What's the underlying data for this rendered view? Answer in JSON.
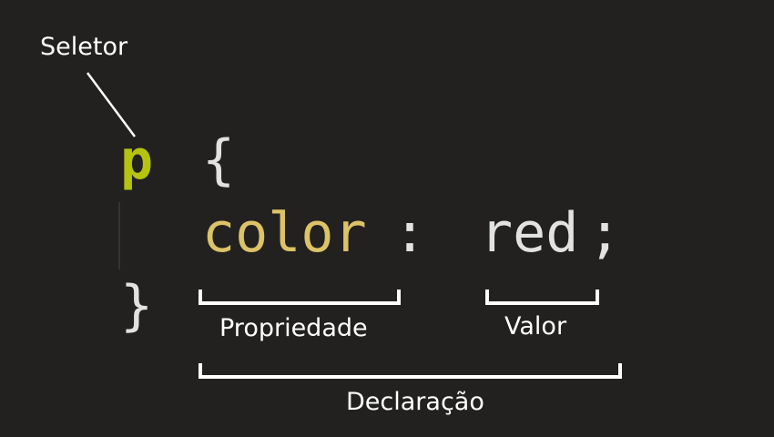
{
  "code": {
    "selector": "p",
    "open_brace": "{",
    "property": "color",
    "colon": ":",
    "value": "red",
    "semicolon": ";",
    "close_brace": "}"
  },
  "labels": {
    "selector": "Seletor",
    "property": "Propriedade",
    "value": "Valor",
    "declaration": "Declaração"
  },
  "colors": {
    "background": "#222120",
    "selector": "#b5c30f",
    "property": "#dcc368",
    "punctuation": "#e2e2e2",
    "annotation": "#ffffff"
  }
}
